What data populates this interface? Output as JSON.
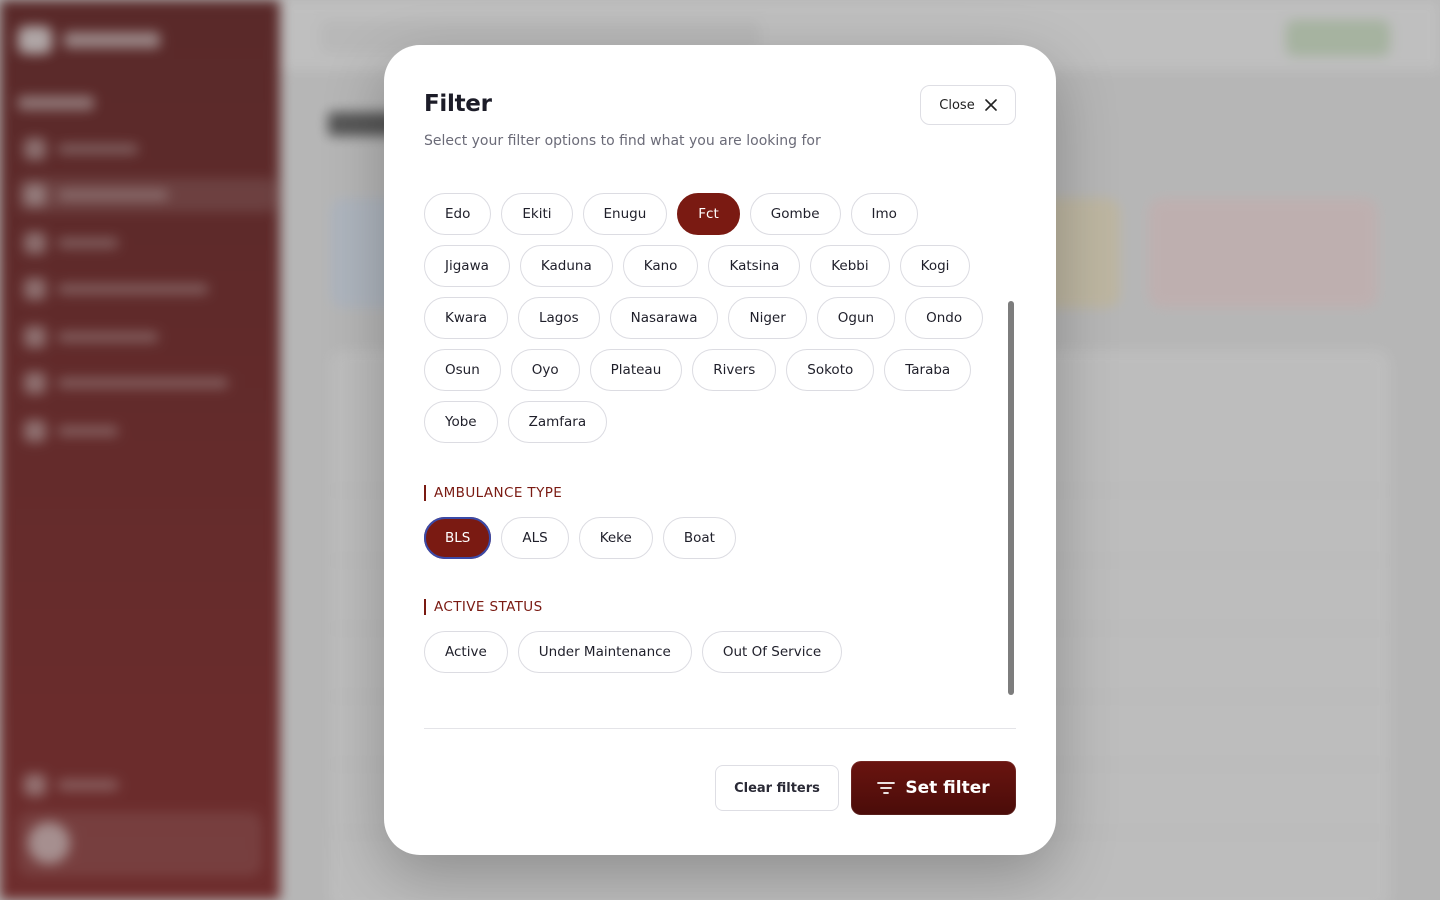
{
  "modal": {
    "title": "Filter",
    "subtitle": "Select your filter options to find what you are looking for",
    "close_label": "Close"
  },
  "states": [
    "Edo",
    "Ekiti",
    "Enugu",
    "Fct",
    "Gombe",
    "Imo",
    "Jigawa",
    "Kaduna",
    "Kano",
    "Katsina",
    "Kebbi",
    "Kogi",
    "Kwara",
    "Lagos",
    "Nasarawa",
    "Niger",
    "Ogun",
    "Ondo",
    "Osun",
    "Oyo",
    "Plateau",
    "Rivers",
    "Sokoto",
    "Taraba",
    "Yobe",
    "Zamfara"
  ],
  "selected_state": "Fct",
  "ambulance_type": {
    "label": "AMBULANCE TYPE",
    "options": [
      "BLS",
      "ALS",
      "Keke",
      "Boat"
    ],
    "selected": "BLS"
  },
  "active_status": {
    "label": "ACTIVE STATUS",
    "options": [
      "Active",
      "Under Maintenance",
      "Out Of Service"
    ]
  },
  "footer": {
    "clear_label": "Clear filters",
    "set_label": "Set filter"
  },
  "colors": {
    "accent": "#7a1a12",
    "sidebar": "#6a1212"
  },
  "icons": {
    "close": "close-icon",
    "filter": "filter-lines-icon"
  }
}
